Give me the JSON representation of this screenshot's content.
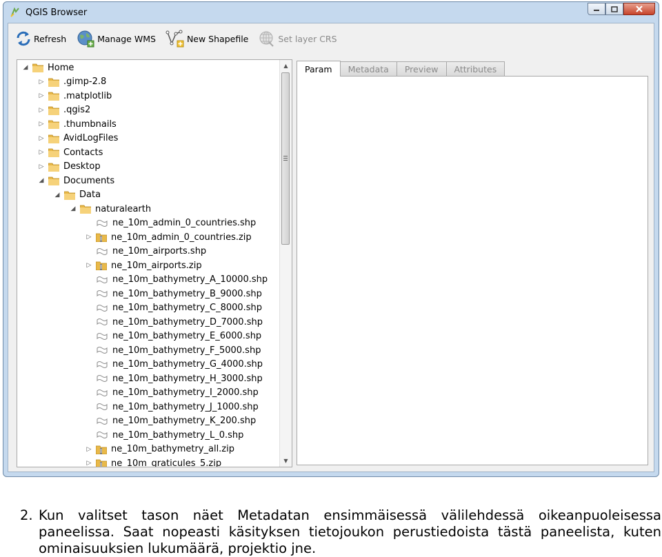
{
  "window": {
    "title": "QGIS Browser"
  },
  "toolbar": {
    "refresh": "Refresh",
    "manage_wms": "Manage WMS",
    "new_shapefile": "New Shapefile",
    "set_layer_crs": "Set layer CRS"
  },
  "tree": {
    "items": [
      {
        "label": "Home",
        "kind": "folder",
        "level": 0,
        "arrow": "expanded"
      },
      {
        "label": ".gimp-2.8",
        "kind": "folder",
        "level": 1,
        "arrow": "collapsed"
      },
      {
        "label": ".matplotlib",
        "kind": "folder",
        "level": 1,
        "arrow": "collapsed"
      },
      {
        "label": ".qgis2",
        "kind": "folder",
        "level": 1,
        "arrow": "collapsed"
      },
      {
        "label": ".thumbnails",
        "kind": "folder",
        "level": 1,
        "arrow": "collapsed"
      },
      {
        "label": "AvidLogFiles",
        "kind": "folder",
        "level": 1,
        "arrow": "collapsed"
      },
      {
        "label": "Contacts",
        "kind": "folder",
        "level": 1,
        "arrow": "collapsed"
      },
      {
        "label": "Desktop",
        "kind": "folder",
        "level": 1,
        "arrow": "collapsed"
      },
      {
        "label": "Documents",
        "kind": "folder",
        "level": 1,
        "arrow": "expanded"
      },
      {
        "label": "Data",
        "kind": "folder",
        "level": 2,
        "arrow": "expanded"
      },
      {
        "label": "naturalearth",
        "kind": "folder",
        "level": 3,
        "arrow": "expanded"
      },
      {
        "label": "ne_10m_admin_0_countries.shp",
        "kind": "shp",
        "level": 4,
        "arrow": "none"
      },
      {
        "label": "ne_10m_admin_0_countries.zip",
        "kind": "zip",
        "level": 4,
        "arrow": "collapsed"
      },
      {
        "label": "ne_10m_airports.shp",
        "kind": "shp",
        "level": 4,
        "arrow": "none"
      },
      {
        "label": "ne_10m_airports.zip",
        "kind": "zip",
        "level": 4,
        "arrow": "collapsed"
      },
      {
        "label": "ne_10m_bathymetry_A_10000.shp",
        "kind": "shp",
        "level": 4,
        "arrow": "none"
      },
      {
        "label": "ne_10m_bathymetry_B_9000.shp",
        "kind": "shp",
        "level": 4,
        "arrow": "none"
      },
      {
        "label": "ne_10m_bathymetry_C_8000.shp",
        "kind": "shp",
        "level": 4,
        "arrow": "none"
      },
      {
        "label": "ne_10m_bathymetry_D_7000.shp",
        "kind": "shp",
        "level": 4,
        "arrow": "none"
      },
      {
        "label": "ne_10m_bathymetry_E_6000.shp",
        "kind": "shp",
        "level": 4,
        "arrow": "none"
      },
      {
        "label": "ne_10m_bathymetry_F_5000.shp",
        "kind": "shp",
        "level": 4,
        "arrow": "none"
      },
      {
        "label": "ne_10m_bathymetry_G_4000.shp",
        "kind": "shp",
        "level": 4,
        "arrow": "none"
      },
      {
        "label": "ne_10m_bathymetry_H_3000.shp",
        "kind": "shp",
        "level": 4,
        "arrow": "none"
      },
      {
        "label": "ne_10m_bathymetry_I_2000.shp",
        "kind": "shp",
        "level": 4,
        "arrow": "none"
      },
      {
        "label": "ne_10m_bathymetry_J_1000.shp",
        "kind": "shp",
        "level": 4,
        "arrow": "none"
      },
      {
        "label": "ne_10m_bathymetry_K_200.shp",
        "kind": "shp",
        "level": 4,
        "arrow": "none"
      },
      {
        "label": "ne_10m_bathymetry_L_0.shp",
        "kind": "shp",
        "level": 4,
        "arrow": "none"
      },
      {
        "label": "ne_10m_bathymetry_all.zip",
        "kind": "zip",
        "level": 4,
        "arrow": "collapsed"
      },
      {
        "label": "ne_10m_graticules_5.zip",
        "kind": "zip",
        "level": 4,
        "arrow": "collapsed"
      }
    ]
  },
  "tabs": [
    {
      "label": "Param",
      "active": true
    },
    {
      "label": "Metadata",
      "active": false
    },
    {
      "label": "Preview",
      "active": false
    },
    {
      "label": "Attributes",
      "active": false
    }
  ],
  "caption": {
    "number": "2.",
    "text": "Kun valitset tason näet Metadatan ensimmäisessä välilehdessä oikeanpuoleisessa paneelissa. Saat nopeasti käsityksen tietojoukon perustiedoista tästä paneelista, kuten ominaisuuksien lukumäärä, projektio jne."
  }
}
